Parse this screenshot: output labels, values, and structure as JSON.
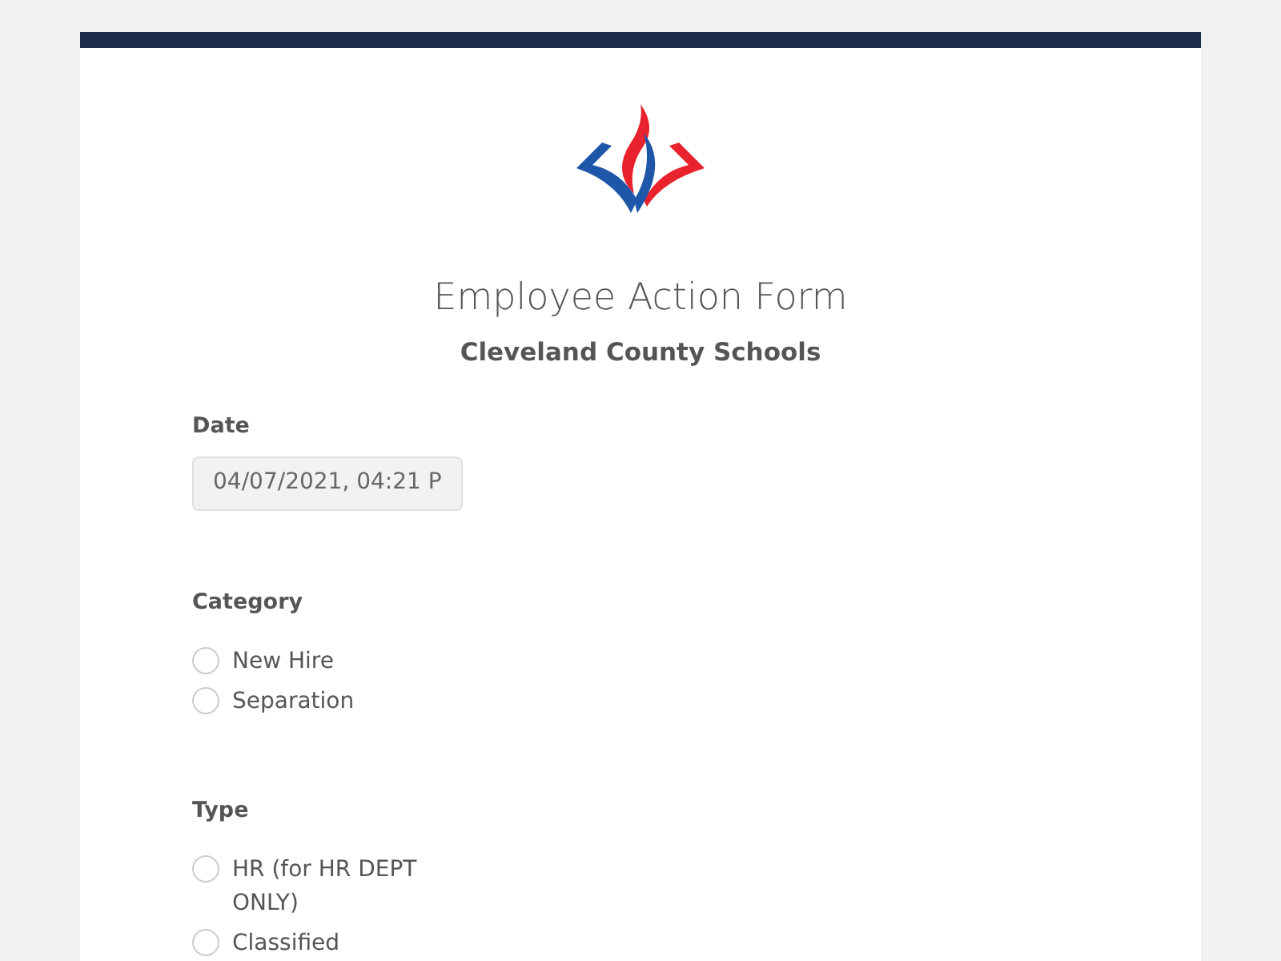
{
  "form": {
    "title": "Employee Action Form",
    "subtitle": "Cleveland County Schools",
    "fields": [
      {
        "kind": "datetime",
        "label": "Date",
        "value": "04/07/2021, 04:21 P"
      },
      {
        "kind": "radio",
        "label": "Category",
        "options": [
          {
            "label": "New Hire",
            "selected": false
          },
          {
            "label": "Separation",
            "selected": false
          }
        ]
      },
      {
        "kind": "radio",
        "label": "Type",
        "options": [
          {
            "label": "HR (for HR DEPT ONLY)",
            "selected": false
          },
          {
            "label": "Classified",
            "selected": false
          }
        ]
      }
    ]
  }
}
